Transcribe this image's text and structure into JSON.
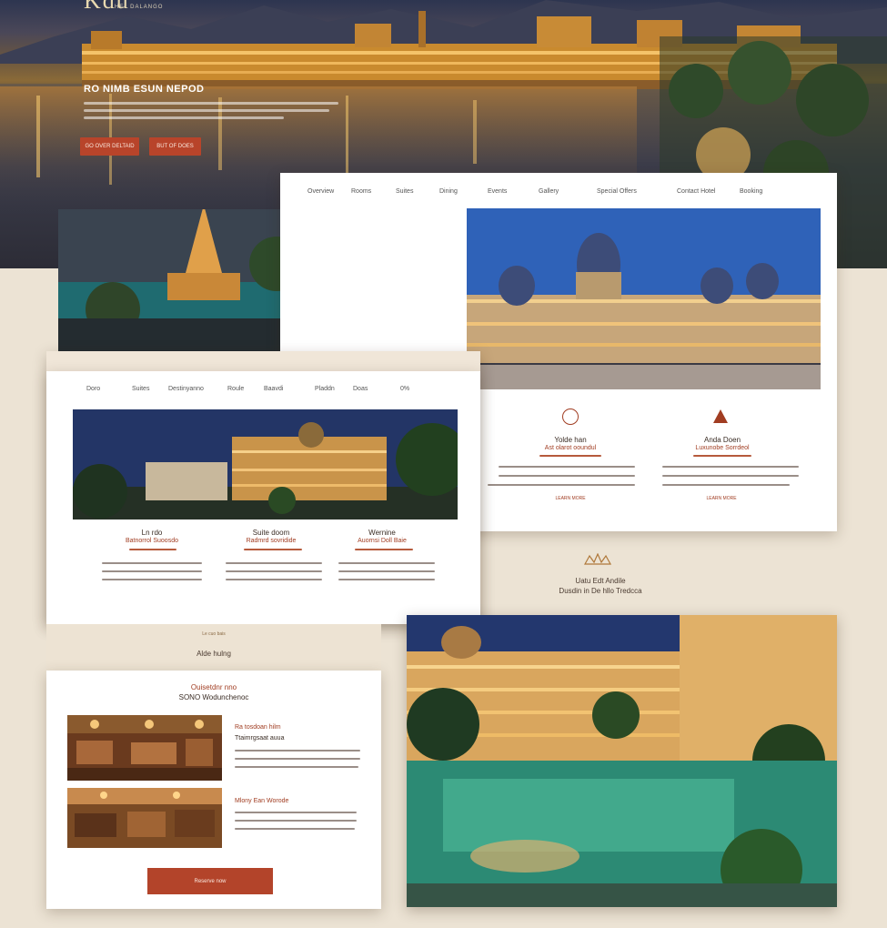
{
  "hero": {
    "logo_text": "Kdu",
    "logo_sub": "HEL DALANGO",
    "title": "RO NIMB ESUN NEPOD",
    "buttons": [
      {
        "label": "GO OVER DELTAID"
      },
      {
        "label": "BUT OF DOES"
      }
    ]
  },
  "nav_top": {
    "items": [
      "Overview",
      "Rooms",
      "Suites",
      "Dining",
      "Events",
      "Gallery",
      "Special Offers",
      "Contact Hotel",
      "Booking"
    ]
  },
  "features_top": [
    {
      "title": "Yolde han",
      "subtitle": "Ast olarot ooundul",
      "link": "LEARN MORE"
    },
    {
      "title": "Anda Doen",
      "subtitle": "Luxunobe Sorrdeol",
      "link": "LEARN MORE"
    }
  ],
  "nav_mid": {
    "items": [
      "Doro",
      "Suites",
      "Destinyanno",
      "Roule",
      "Baavdi",
      "Pladdn",
      "Doas"
    ],
    "search_label": "0%"
  },
  "features_mid": [
    {
      "title": "Ln rdo",
      "subtitle": "Batnorrol Suoosdo"
    },
    {
      "title": "Suite doom",
      "subtitle": "Radmrd sovridide"
    },
    {
      "title": "Wernine",
      "subtitle": "Auornsi Doll Baie"
    }
  ],
  "section_heading_right": {
    "line1": "Uatu Edt Andile",
    "line2": "Dusdin in De hllo Tredcca"
  },
  "section_heading_left": {
    "small": "Le cuo bais",
    "main": "Alde hulng"
  },
  "dining": {
    "kicker": "Ouisetdnr nno",
    "title": "SONO Wodunchenoc",
    "items": [
      {
        "title": "Ra tosdoan hilm",
        "subtitle": "Ttaimrgsaat auua"
      },
      {
        "title": "Mlony Ean Worode",
        "subtitle": ""
      }
    ],
    "button_label": "Reserve now"
  },
  "colors": {
    "accent": "#b3442a",
    "background": "#ece3d4",
    "card": "#ffffff"
  }
}
